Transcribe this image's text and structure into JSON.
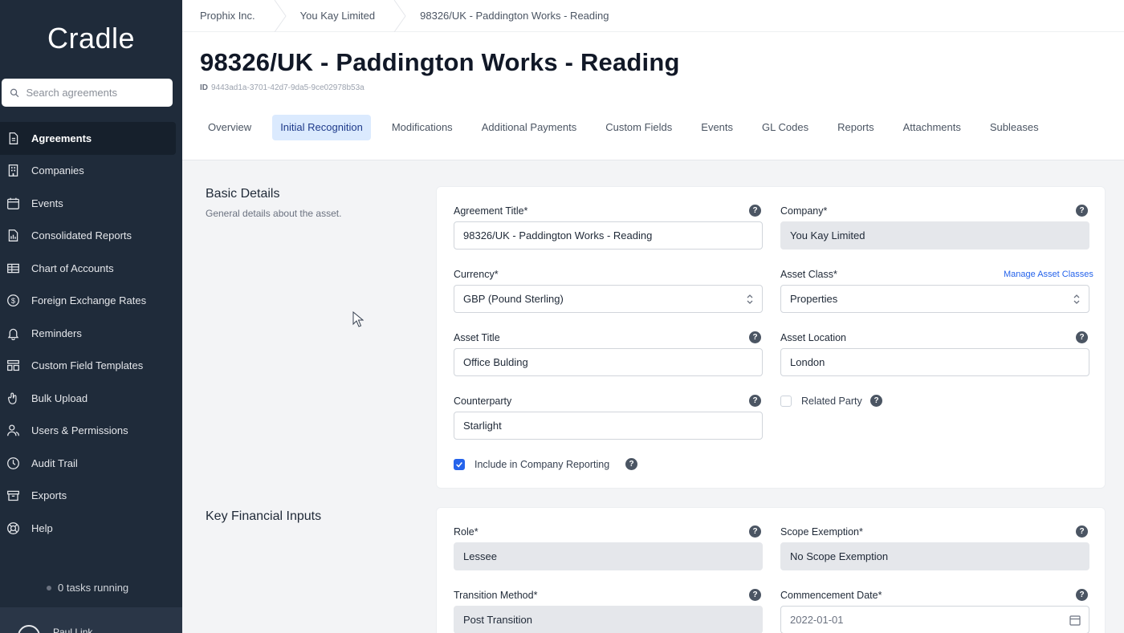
{
  "brand": "Cradle",
  "search": {
    "placeholder": "Search agreements"
  },
  "nav": [
    {
      "label": "Agreements",
      "icon": "document-icon"
    },
    {
      "label": "Companies",
      "icon": "building-icon"
    },
    {
      "label": "Events",
      "icon": "calendar-icon"
    },
    {
      "label": "Consolidated Reports",
      "icon": "report-icon"
    },
    {
      "label": "Chart of Accounts",
      "icon": "table-icon"
    },
    {
      "label": "Foreign Exchange Rates",
      "icon": "dollar-icon"
    },
    {
      "label": "Reminders",
      "icon": "bell-icon"
    },
    {
      "label": "Custom Field Templates",
      "icon": "template-icon"
    },
    {
      "label": "Bulk Upload",
      "icon": "upload-icon"
    },
    {
      "label": "Users & Permissions",
      "icon": "users-icon"
    },
    {
      "label": "Audit Trail",
      "icon": "clock-icon"
    },
    {
      "label": "Exports",
      "icon": "archive-icon"
    },
    {
      "label": "Help",
      "icon": "lifebuoy-icon"
    }
  ],
  "tasks": "0 tasks running",
  "user": {
    "name": "Paul Link"
  },
  "breadcrumb": [
    "Prophix Inc.",
    "You Kay Limited",
    "98326/UK - Paddington Works - Reading"
  ],
  "page": {
    "title": "98326/UK - Paddington Works - Reading",
    "id_label": "ID",
    "id_value": "9443ad1a-3701-42d7-9da5-9ce02978b53a"
  },
  "tabs": [
    "Overview",
    "Initial Recognition",
    "Modifications",
    "Additional Payments",
    "Custom Fields",
    "Events",
    "GL Codes",
    "Reports",
    "Attachments",
    "Subleases"
  ],
  "basic": {
    "title": "Basic Details",
    "subtitle": "General details about the asset.",
    "agreement_title_label": "Agreement Title*",
    "agreement_title_value": "98326/UK - Paddington Works - Reading",
    "company_label": "Company*",
    "company_value": "You Kay Limited",
    "currency_label": "Currency*",
    "currency_value": "GBP (Pound Sterling)",
    "asset_class_label": "Asset Class*",
    "manage_link": "Manage Asset Classes",
    "asset_class_value": "Properties",
    "asset_title_label": "Asset Title",
    "asset_title_value": "Office Bulding",
    "asset_location_label": "Asset Location",
    "asset_location_value": "London",
    "counterparty_label": "Counterparty",
    "counterparty_value": "Starlight",
    "related_party_label": "Related Party",
    "include_label": "Include in Company Reporting",
    "include_checked": true,
    "related_checked": false
  },
  "financial": {
    "title": "Key Financial Inputs",
    "role_label": "Role*",
    "role_value": "Lessee",
    "scope_label": "Scope Exemption*",
    "scope_value": "No Scope Exemption",
    "transition_label": "Transition Method*",
    "transition_value": "Post Transition",
    "commencement_label": "Commencement Date*",
    "commencement_value": "2022-01-01"
  },
  "help_glyph": "?",
  "colors": {
    "sidebar": "#1f2b3a",
    "accent": "#2563eb",
    "active_tab_bg": "#dbeafe"
  }
}
